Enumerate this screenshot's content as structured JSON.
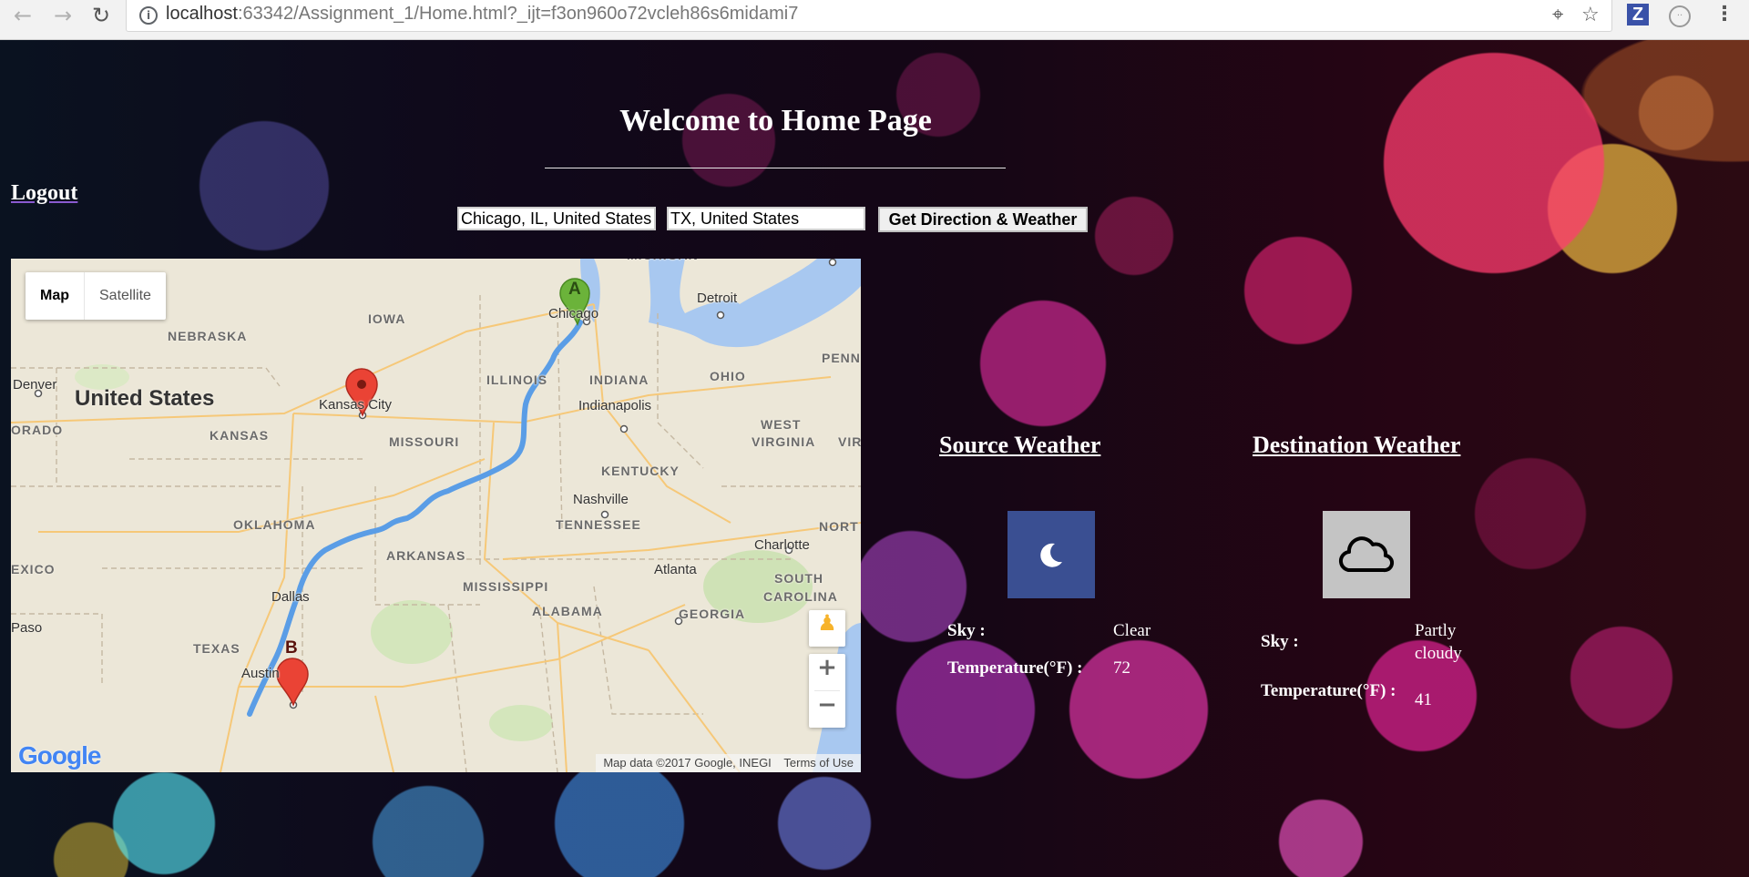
{
  "browser": {
    "url_host": "localhost",
    "url_rest": ":63342/Assignment_1/Home.html?_ijt=f3on960o72vcleh86s6midami7",
    "ext_letter": "Z"
  },
  "page": {
    "title": "Welcome to Home Page",
    "logout": "Logout",
    "source_value": "Chicago, IL, United States",
    "destination_value": "TX, United States",
    "submit_label": "Get Direction & Weather"
  },
  "map": {
    "type_map": "Map",
    "type_satellite": "Satellite",
    "attribution": "Map data ©2017 Google, INEGI",
    "terms": "Terms of Use",
    "logo": "Google",
    "marker_a": "A",
    "marker_b": "B",
    "labels": [
      {
        "text": "IOWA",
        "kind": "state"
      },
      {
        "text": "NEBRASKA",
        "kind": "state"
      },
      {
        "text": "United States",
        "kind": "country"
      },
      {
        "text": "Denver",
        "kind": "city"
      },
      {
        "text": "ORADO",
        "kind": "state"
      },
      {
        "text": "KANSAS",
        "kind": "state"
      },
      {
        "text": "Kansas City",
        "kind": "city"
      },
      {
        "text": "MISSOURI",
        "kind": "state"
      },
      {
        "text": "ILLINOIS",
        "kind": "state"
      },
      {
        "text": "INDIANA",
        "kind": "state"
      },
      {
        "text": "OHIO",
        "kind": "state"
      },
      {
        "text": "PENN",
        "kind": "state"
      },
      {
        "text": "Chicago",
        "kind": "city"
      },
      {
        "text": "Detroit",
        "kind": "city"
      },
      {
        "text": "Indianapolis",
        "kind": "city"
      },
      {
        "text": "WEST",
        "kind": "state"
      },
      {
        "text": "VIRGINIA",
        "kind": "state"
      },
      {
        "text": "VIRGI",
        "kind": "state"
      },
      {
        "text": "KENTUCKY",
        "kind": "state"
      },
      {
        "text": "Nashville",
        "kind": "city"
      },
      {
        "text": "TENNESSEE",
        "kind": "state"
      },
      {
        "text": "OKLAHOMA",
        "kind": "state"
      },
      {
        "text": "ARKANSAS",
        "kind": "state"
      },
      {
        "text": "NORT",
        "kind": "state"
      },
      {
        "text": "Charlotte",
        "kind": "city"
      },
      {
        "text": "SOUTH",
        "kind": "state"
      },
      {
        "text": "CAROLINA",
        "kind": "state"
      },
      {
        "text": "EXICO",
        "kind": "state"
      },
      {
        "text": "MISSISSIPPI",
        "kind": "state"
      },
      {
        "text": "Atlanta",
        "kind": "city"
      },
      {
        "text": "ALABAMA",
        "kind": "state"
      },
      {
        "text": "GEORGIA",
        "kind": "state"
      },
      {
        "text": "Dallas",
        "kind": "city"
      },
      {
        "text": "Paso",
        "kind": "city"
      },
      {
        "text": "TEXAS",
        "kind": "state"
      },
      {
        "text": "Austin",
        "kind": "city"
      },
      {
        "text": "MICHIGAN",
        "kind": "state"
      }
    ]
  },
  "weather": {
    "source": {
      "heading": "Source Weather",
      "sky_label": "Sky :",
      "sky_value": "Clear",
      "temp_label": "Temperature(°F) :",
      "temp_value": "72",
      "icon": "moon-icon",
      "icon_bg": "#3a4f92"
    },
    "destination": {
      "heading": "Destination Weather",
      "sky_label": "Sky :",
      "sky_value": "Partly cloudy",
      "temp_label": "Temperature(°F) :",
      "temp_value": "41",
      "icon": "cloud-icon",
      "icon_bg": "#c4c4c4"
    }
  }
}
